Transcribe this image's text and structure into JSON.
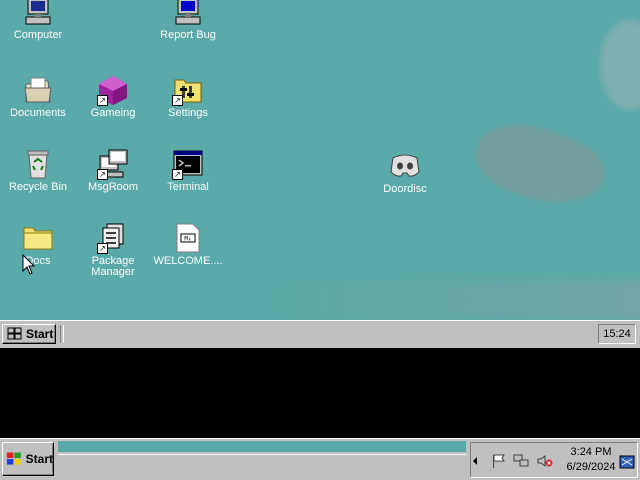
{
  "desktop": {
    "background_color": "#59aaa8",
    "icons": [
      {
        "label": "Computer",
        "icon": "computer-icon"
      },
      {
        "label": "Report Bug",
        "icon": "report-bug-icon"
      },
      {
        "label": "Documents",
        "icon": "documents-icon"
      },
      {
        "label": "Gameing",
        "icon": "gaming-icon"
      },
      {
        "label": "Settings",
        "icon": "settings-icon"
      },
      {
        "label": "Recycle Bin",
        "icon": "recycle-bin-icon"
      },
      {
        "label": "MsgRoom",
        "icon": "msgroom-icon"
      },
      {
        "label": "Terminal",
        "icon": "terminal-icon"
      },
      {
        "label": "Doordisc",
        "icon": "doordisc-icon"
      },
      {
        "label": "Docs",
        "icon": "folder-icon"
      },
      {
        "label": "Package Manager",
        "icon": "package-manager-icon"
      },
      {
        "label": "WELCOME....",
        "icon": "markdown-file-icon"
      }
    ]
  },
  "inner_taskbar": {
    "start_label": "Start",
    "clock": "15:24"
  },
  "host_taskbar": {
    "start_label": "Start",
    "time": "3:24 PM",
    "date": "6/29/2024",
    "tray_icons": [
      "flag-icon",
      "network-icon",
      "volume-muted-icon",
      "keyboard-icon"
    ]
  }
}
